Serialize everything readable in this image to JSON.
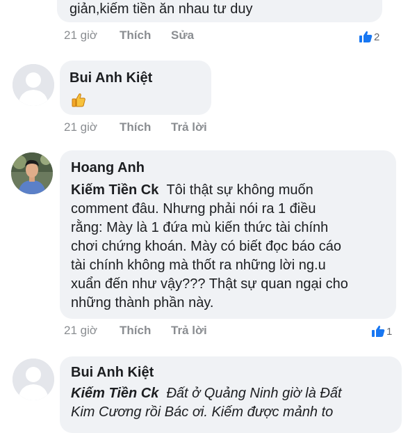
{
  "comments": [
    {
      "text_tail": "giản,kiếm tiền ăn nhau tư duy",
      "time": "21 giờ",
      "like_label": "Thích",
      "action_label": "Sửa",
      "reaction_count": "2"
    },
    {
      "author": "Bui Anh Kiệt",
      "time": "21 giờ",
      "like_label": "Thích",
      "action_label": "Trả lời",
      "emoji": "thumbs-up"
    },
    {
      "author": "Hoang Anh",
      "mention": "Kiếm Tiền Ck",
      "lines": [
        "Tôi thật sự không muốn",
        "comment đâu. Nhưng phải nói ra 1 điều",
        "rằng: Mày là 1 đứa mù kiến thức tài chính",
        "chơi chứng khoán. Mày có biết đọc báo cáo",
        "tài chính không mà thốt ra những lời ng.u",
        "xuẩn đến như vậy??? Thật sự quan ngại cho",
        "những thành phần này."
      ],
      "time": "21 giờ",
      "like_label": "Thích",
      "action_label": "Trả lời",
      "reaction_count": "1"
    },
    {
      "author": "Bui Anh Kiệt",
      "mention": "Kiếm Tiền Ck",
      "line1": "Đất ở Quảng Ninh giờ là Đất",
      "line2": "Kim Cương rồi Bác ơi. Kiếm được mảnh to"
    }
  ],
  "colors": {
    "bubble": "#f0f2f5",
    "meta_text": "#8a8d91",
    "like_blue": "#1877f2"
  }
}
